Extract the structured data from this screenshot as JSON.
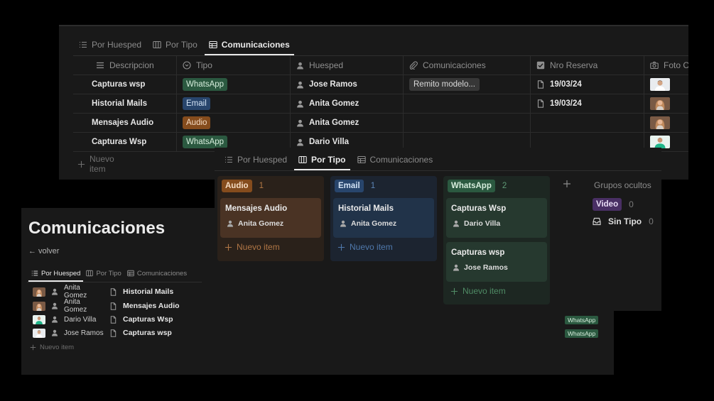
{
  "table_view": {
    "tabs": [
      {
        "label": "Por Huesped",
        "icon": "list-icon"
      },
      {
        "label": "Por Tipo",
        "icon": "board-icon"
      },
      {
        "label": "Comunicaciones",
        "icon": "table-icon",
        "active": true
      }
    ],
    "columns": [
      {
        "label": "Descripcion",
        "icon": "text-lines-icon"
      },
      {
        "label": "Tipo",
        "icon": "select-icon"
      },
      {
        "label": "Huesped",
        "icon": "person-icon"
      },
      {
        "label": "Comunicaciones",
        "icon": "paperclip-icon"
      },
      {
        "label": "Nro Reserva",
        "icon": "checkbox-icon"
      },
      {
        "label": "Foto Cli",
        "icon": "camera-icon"
      }
    ],
    "rows": [
      {
        "descripcion": "Capturas wsp",
        "tipo": "WhatsApp",
        "huesped": "Jose Ramos",
        "comunicacion": "Remito modelo...",
        "nro_reserva": "19/03/24"
      },
      {
        "descripcion": "Historial Mails",
        "tipo": "Email",
        "huesped": "Anita Gomez",
        "comunicacion": "",
        "nro_reserva": "19/03/24"
      },
      {
        "descripcion": "Mensajes Audio",
        "tipo": "Audio",
        "huesped": "Anita Gomez",
        "comunicacion": "",
        "nro_reserva": ""
      },
      {
        "descripcion": "Capturas Wsp",
        "tipo": "WhatsApp",
        "huesped": "Dario Villa",
        "comunicacion": "",
        "nro_reserva": ""
      }
    ],
    "new_item_label": "Nuevo item"
  },
  "board_view": {
    "tabs": [
      {
        "label": "Por Huesped",
        "icon": "list-icon"
      },
      {
        "label": "Por Tipo",
        "icon": "board-icon",
        "active": true
      },
      {
        "label": "Comunicaciones",
        "icon": "table-icon"
      }
    ],
    "columns": [
      {
        "tag": "Audio",
        "count": "1",
        "cards": [
          {
            "title": "Mensajes Audio",
            "person": "Anita Gomez"
          }
        ]
      },
      {
        "tag": "Email",
        "count": "1",
        "cards": [
          {
            "title": "Historial Mails",
            "person": "Anita Gomez"
          }
        ]
      },
      {
        "tag": "WhatsApp",
        "count": "2",
        "cards": [
          {
            "title": "Capturas Wsp",
            "person": "Dario Villa"
          },
          {
            "title": "Capturas wsp",
            "person": "Jose Ramos"
          }
        ]
      }
    ],
    "new_item_label": "Nuevo item",
    "add_group_symbol": "+",
    "hidden_groups_label": "Grupos ocultos",
    "hidden_groups": [
      {
        "label": "Video",
        "count": "0"
      },
      {
        "label": "Sin Tipo",
        "count": "0"
      }
    ]
  },
  "list_view": {
    "title": "Comunicaciones",
    "back_link": "← volver",
    "tabs": [
      {
        "label": "Por Huesped",
        "icon": "list-icon",
        "active": true
      },
      {
        "label": "Por Tipo",
        "icon": "board-icon"
      },
      {
        "label": "Comunicaciones",
        "icon": "table-icon"
      }
    ],
    "rows": [
      {
        "person": "Anita Gomez",
        "descripcion": "Historial Mails",
        "tag": ""
      },
      {
        "person": "Anita Gomez",
        "descripcion": "Mensajes Audio",
        "tag": ""
      },
      {
        "person": "Dario Villa",
        "descripcion": "Capturas Wsp",
        "tag": "WhatsApp"
      },
      {
        "person": "Jose Ramos",
        "descripcion": "Capturas wsp",
        "tag": "WhatsApp"
      }
    ],
    "new_item_label": "Nuevo item"
  },
  "colors": {
    "background": "#191919",
    "whatsapp_tag": "#2b5940",
    "email_tag": "#28456c",
    "audio_tag": "#854c1d",
    "video_tag": "#492f64"
  }
}
